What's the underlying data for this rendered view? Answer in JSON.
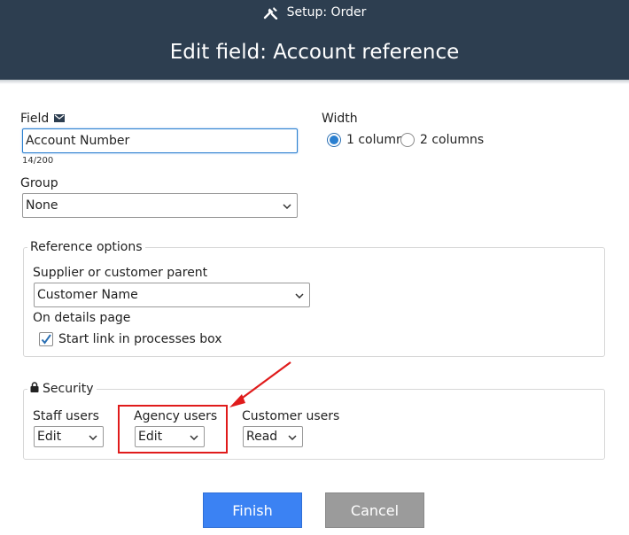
{
  "header": {
    "breadcrumb": "Setup: Order",
    "title": "Edit field: Account reference",
    "tools_icon": "tools-icon",
    "background": "#2d3e50"
  },
  "field": {
    "label": "Field",
    "label_icon": "envelope-icon",
    "value": "Account Number",
    "char_count": "14/200"
  },
  "width": {
    "label": "Width",
    "options": [
      "1 column",
      "2 columns"
    ],
    "selected": "1 column"
  },
  "group": {
    "label": "Group",
    "selected": "None"
  },
  "reference_options": {
    "legend": "Reference options",
    "parent_label": "Supplier or customer parent",
    "parent_selected": "Customer Name",
    "details_label": "On details page",
    "start_link_label": "Start link in processes box",
    "start_link_checked": true
  },
  "security": {
    "legend": "Security",
    "legend_icon": "lock-icon",
    "staff": {
      "label": "Staff users",
      "selected": "Edit"
    },
    "agency": {
      "label": "Agency users",
      "selected": "Edit"
    },
    "customer": {
      "label": "Customer users",
      "selected": "Read"
    }
  },
  "actions": {
    "finish": "Finish",
    "cancel": "Cancel"
  },
  "colors": {
    "accent": "#3b82f3",
    "annotation": "#e01b1b"
  }
}
